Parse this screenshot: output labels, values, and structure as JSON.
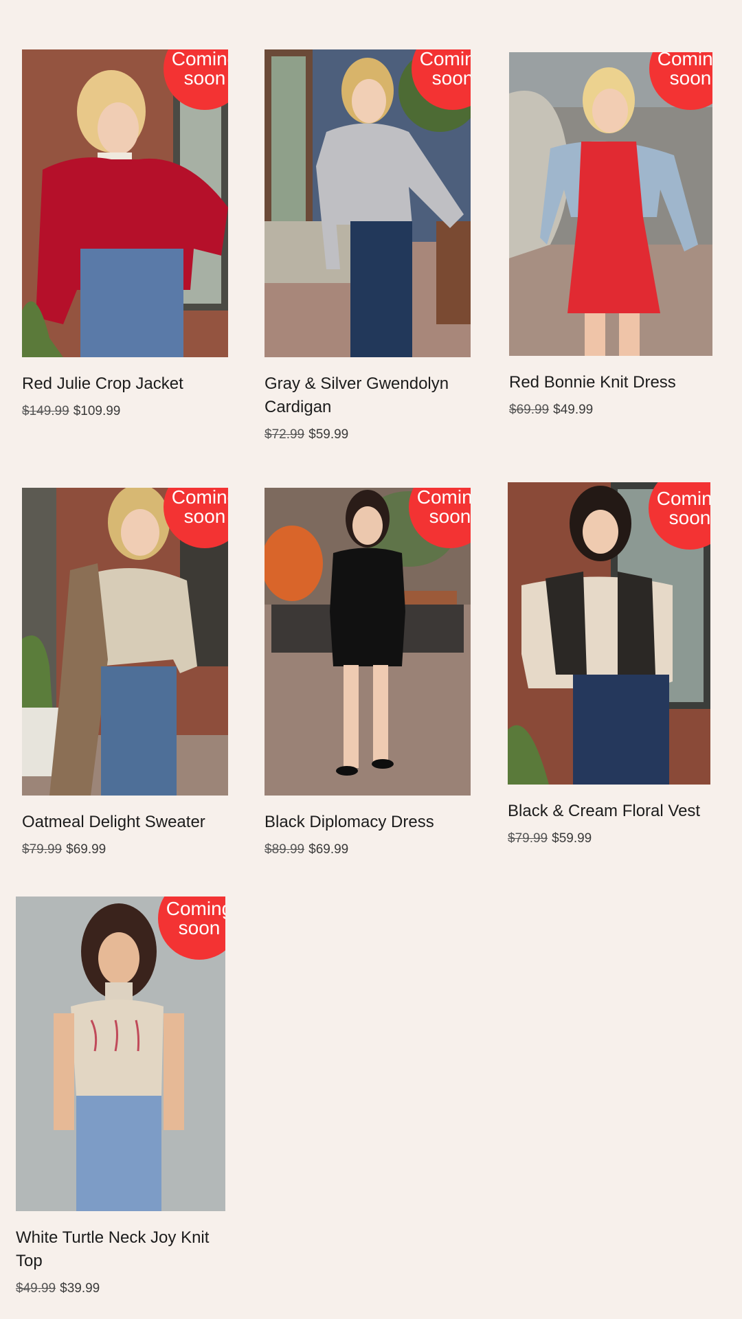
{
  "badge": {
    "line1": "Coming",
    "line2": "soon",
    "color": "#f33333"
  },
  "products": [
    {
      "title": "Red Julie Crop Jacket",
      "original_price": "$149.99",
      "sale_price": "$109.99"
    },
    {
      "title": "Gray & Silver Gwendolyn Cardigan",
      "original_price": "$72.99",
      "sale_price": "$59.99"
    },
    {
      "title": "Red Bonnie Knit Dress",
      "original_price": "$69.99",
      "sale_price": "$49.99"
    },
    {
      "title": "Oatmeal Delight Sweater",
      "original_price": "$79.99",
      "sale_price": "$69.99"
    },
    {
      "title": "Black Diplomacy Dress",
      "original_price": "$89.99",
      "sale_price": "$69.99"
    },
    {
      "title": "Black & Cream Floral Vest",
      "original_price": "$79.99",
      "sale_price": "$59.99"
    },
    {
      "title": "White Turtle Neck Joy Knit Top",
      "original_price": "$49.99",
      "sale_price": "$39.99"
    }
  ],
  "colors": {
    "background": "#f7f0eb",
    "text": "#1c1c1c"
  }
}
